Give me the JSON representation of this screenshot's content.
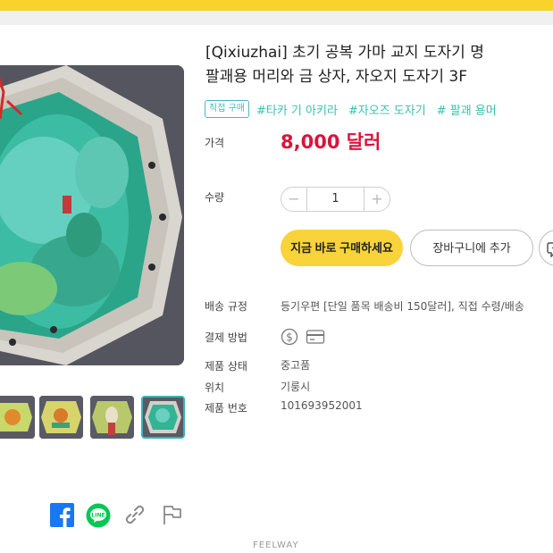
{
  "product": {
    "title_line1": "[Qixiuzhai] 초기 공복 가마 교지 도자기 명",
    "title_line2": "팔괘용 머리와 금 상자, 자오지 도자기 3F",
    "badge": "직접 구매",
    "hashtags": [
      "#타카 기 아키라",
      "#자오즈 도자기",
      "# 팔괘 용머"
    ]
  },
  "price": {
    "label": "가격",
    "value": "8,000 달러",
    "color": "#d9143c"
  },
  "quantity": {
    "label": "수량",
    "value": "1",
    "minus": "−",
    "plus": "+"
  },
  "actions": {
    "buy_now": "지금 바로 구매하세요",
    "add_to_cart": "장바구니에 추가"
  },
  "details": {
    "shipping_label": "배송 규정",
    "shipping_value": "등기우편 [단일 품목 배송비 150달러], 직접 수령/배송",
    "payment_label": "결제 방법",
    "condition_label": "제품 상태",
    "condition_value": "중고품",
    "location_label": "위치",
    "location_value": "기룽시",
    "product_no_label": "제품 번호",
    "product_no_value": "101693952001"
  },
  "icons": {
    "payment": [
      "dollar-coin-icon",
      "credit-card-icon"
    ],
    "share": [
      "facebook-icon",
      "line-icon",
      "link-icon",
      "report-flag-icon"
    ],
    "chat": "chat-bubble-icon"
  },
  "colors": {
    "accent_yellow": "#f9d33a",
    "teal": "#3dbfae",
    "price_red": "#d9143c",
    "facebook": "#1877f2",
    "line_green": "#06c755"
  },
  "footer": {
    "brand": "FEELWAY"
  }
}
